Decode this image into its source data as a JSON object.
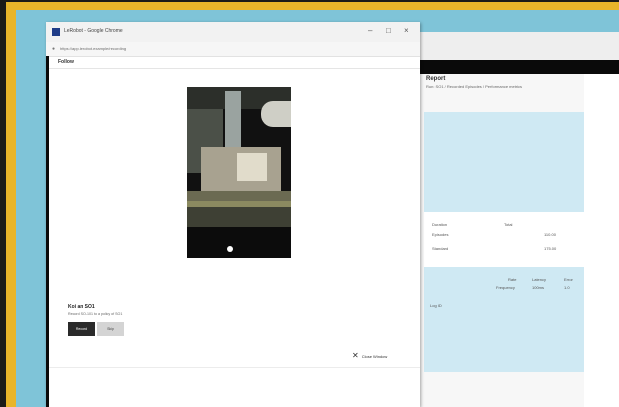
{
  "window": {
    "title": "LeRobot - Google Chrome",
    "url": "https://app.lerobot.example/recording",
    "controls": {
      "minimize": "–",
      "maximize": "□",
      "close": "×"
    }
  },
  "tabs": [
    {
      "label": "Follow"
    }
  ],
  "video": {
    "description_icon": "play-indicator"
  },
  "card": {
    "title": "Koi an SO1",
    "description": "Record SO-101 to a policy of SO1",
    "primary_button": "Record",
    "secondary_button": "Skip"
  },
  "actions": {
    "close_label": "Close Window",
    "close_icon": "close-icon"
  },
  "background_window": {
    "report_title": "Report",
    "report_subtitle": "Run: SO1 / Recorded Episodes / Performance metrics",
    "rows": [
      {
        "label": "Duration",
        "col": "Total",
        "value": ""
      },
      {
        "label": "Episodes",
        "col": "",
        "value": "110.00"
      },
      {
        "label": "Standard",
        "col": "",
        "value": "175.00"
      }
    ],
    "table_headers": [
      "Rate",
      "Latency",
      "Error"
    ],
    "table_values": [
      "Frequency",
      "100ms",
      "1.0"
    ],
    "footnote": "Log ID"
  },
  "colors": {
    "frame": "#e8b52a",
    "desktop": "#7fc4d8",
    "panel": "#cfe9f3",
    "accent": "#0a0a0a"
  }
}
